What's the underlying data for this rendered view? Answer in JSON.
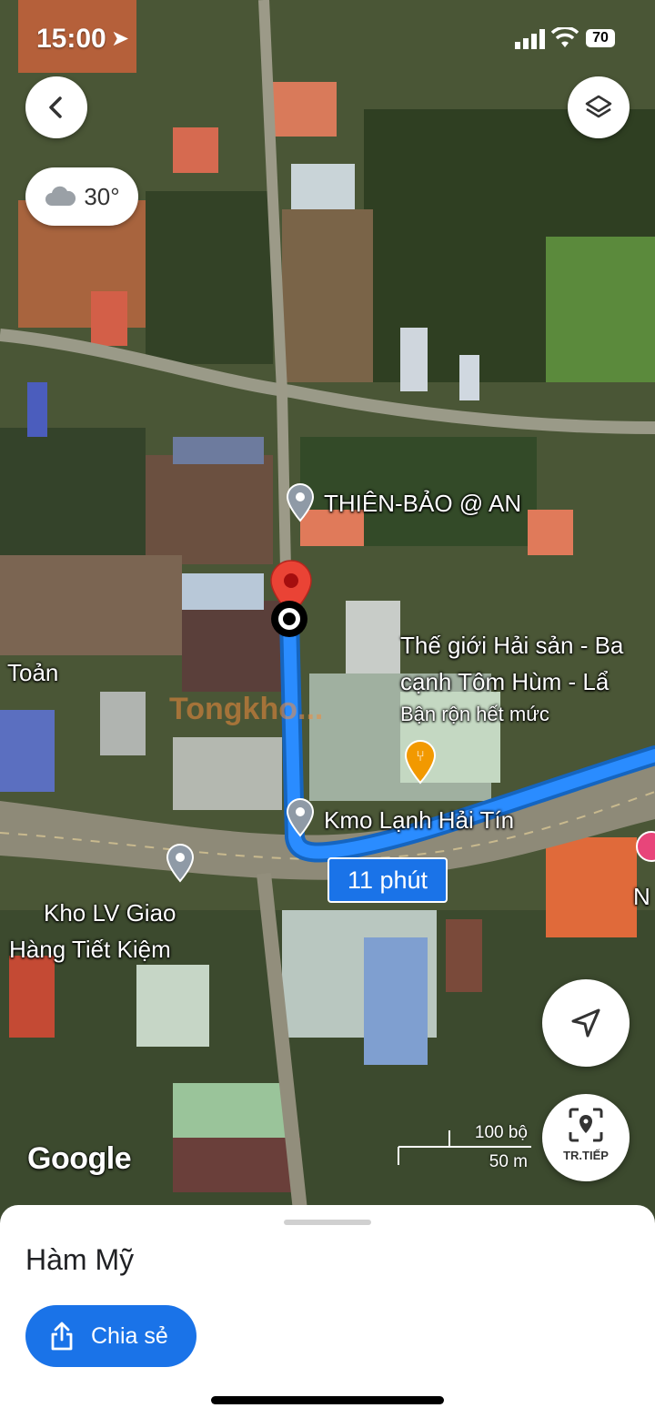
{
  "status_bar": {
    "time": "15:00",
    "battery": "70"
  },
  "weather": {
    "temperature": "30°",
    "icon": "cloud-icon"
  },
  "map": {
    "labels": {
      "poi1": "THIÊN-BẢO @ AN",
      "poi2_line1": "Thế giới Hải sản - Ba",
      "poi2_line2": "cạnh Tôm Hùm - Lẩ",
      "poi2_desc": "Bận rộn hết mức",
      "poi3": "Kmo Lạnh Hải Tín",
      "poi4_line1": "Kho LV Giao",
      "poi4_line2": "Hàng Tiết Kiệm",
      "left_edge": "Toản",
      "right_edge": "N"
    },
    "eta": "11 phút",
    "attribution": "Google",
    "scale": {
      "imperial": "100 bộ",
      "metric": "50 m"
    },
    "watermark": "Tongkho..."
  },
  "buttons": {
    "back_icon": "back-arrow-icon",
    "layers_icon": "layers-icon",
    "my_location_icon": "navigation-arrow-icon",
    "track_label": "TR.TIẾP"
  },
  "sheet": {
    "place_name": "Hàm Mỹ",
    "share_label": "Chia sẻ"
  },
  "colors": {
    "route": "#2a8cff",
    "accent": "#1a73e8",
    "pin": "#ea4335"
  }
}
